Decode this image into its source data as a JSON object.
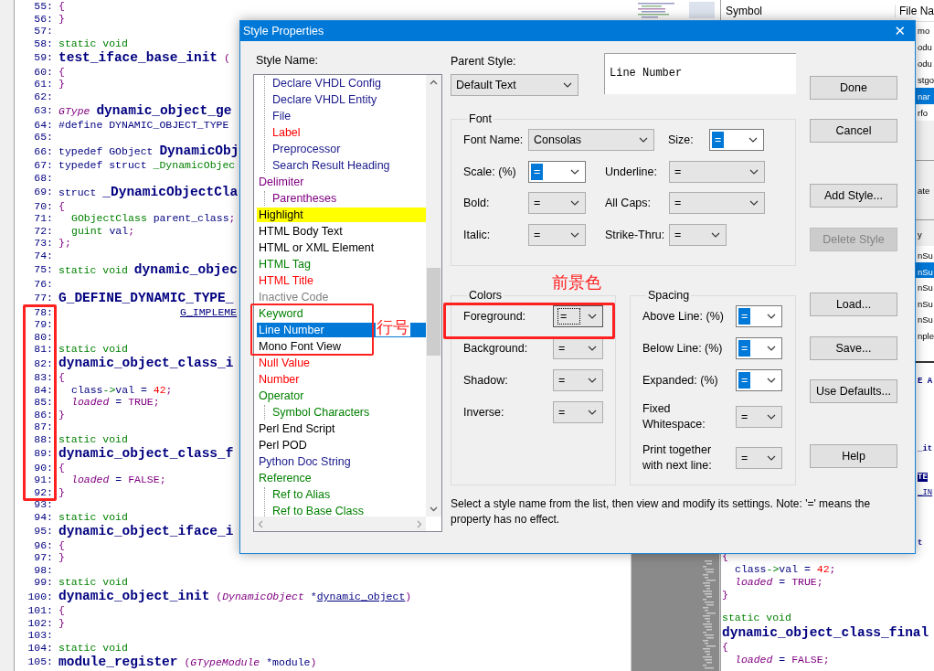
{
  "editor": {
    "lines": [
      {
        "n": "55:",
        "tokens": [
          {
            "t": "{",
            "kind": "punct"
          }
        ]
      },
      {
        "n": "56:",
        "tokens": [
          {
            "t": "}",
            "kind": "punct"
          }
        ]
      },
      {
        "n": "57:"
      },
      {
        "n": "58:",
        "tokens": [
          {
            "t": "static void",
            "kind": "kw"
          }
        ]
      },
      {
        "n": "59:",
        "tokens": [
          {
            "t": "test_iface_base_init",
            "kind": "fn"
          },
          {
            "t": " (",
            "kind": "punct"
          }
        ]
      },
      {
        "n": "60:",
        "tokens": [
          {
            "t": "{",
            "kind": "punct"
          }
        ]
      },
      {
        "n": "61:",
        "tokens": [
          {
            "t": "}",
            "kind": "punct"
          }
        ]
      },
      {
        "n": "62:"
      },
      {
        "n": "63:",
        "tokens": [
          {
            "t": "GType ",
            "kind": "type"
          },
          {
            "t": "dynamic_object_ge",
            "kind": "fn"
          }
        ]
      },
      {
        "n": "64:",
        "tokens": [
          {
            "t": "#define DYNAMIC_OBJECT_TYPE",
            "kind": "plain"
          }
        ]
      },
      {
        "n": "65:"
      },
      {
        "n": "66:",
        "tokens": [
          {
            "t": "typedef GObject ",
            "kind": "plain"
          },
          {
            "t": "DynamicObj",
            "kind": "fn"
          }
        ]
      },
      {
        "n": "67:",
        "tokens": [
          {
            "t": "typedef struct ",
            "kind": "plain"
          },
          {
            "t": "_DynamicObjec",
            "kind": "kw"
          }
        ]
      },
      {
        "n": "68:"
      },
      {
        "n": "69:",
        "tokens": [
          {
            "t": "struct ",
            "kind": "plain"
          },
          {
            "t": "_DynamicObjectCla",
            "kind": "fn"
          }
        ]
      },
      {
        "n": "70:",
        "tokens": [
          {
            "t": "{",
            "kind": "punct"
          }
        ]
      },
      {
        "n": "71:",
        "kind": "body",
        "tokens": [
          {
            "t": "GObjectClass ",
            "kind": "kw"
          },
          {
            "t": "parent_class",
            "kind": "plain"
          },
          {
            "t": ";",
            "kind": "punct"
          }
        ]
      },
      {
        "n": "72:",
        "kind": "body",
        "tokens": [
          {
            "t": "guint ",
            "kind": "kw"
          },
          {
            "t": "val",
            "kind": "plain"
          },
          {
            "t": ";",
            "kind": "punct"
          }
        ]
      },
      {
        "n": "73:",
        "tokens": [
          {
            "t": "};",
            "kind": "punct"
          }
        ]
      },
      {
        "n": "74:"
      },
      {
        "n": "75:",
        "tokens": [
          {
            "t": "static void ",
            "kind": "kw"
          },
          {
            "t": "dynamic_objec",
            "kind": "fn"
          }
        ]
      },
      {
        "n": "76:"
      },
      {
        "n": "77:",
        "tokens": [
          {
            "t": "G_DEFINE_DYNAMIC_TYPE_",
            "kind": "fn"
          }
        ]
      },
      {
        "n": "78:",
        "kind": "continuation",
        "tokens": [
          {
            "t": "G_IMPLEME",
            "kind": "link"
          }
        ]
      },
      {
        "n": "79:"
      },
      {
        "n": "80:"
      },
      {
        "n": "81:",
        "tokens": [
          {
            "t": "static void",
            "kind": "kw"
          }
        ]
      },
      {
        "n": "82:",
        "tokens": [
          {
            "t": "dynamic_object_class_i",
            "kind": "fn"
          }
        ]
      },
      {
        "n": "83:",
        "tokens": [
          {
            "t": "{",
            "kind": "punct"
          }
        ]
      },
      {
        "n": "84:",
        "kind": "body",
        "tokens": [
          {
            "t": "class",
            "kind": "plain"
          },
          {
            "t": "->",
            "kind": "kw"
          },
          {
            "t": "val = ",
            "kind": "plain"
          },
          {
            "t": "42",
            "kind": "num"
          },
          {
            "t": ";",
            "kind": "punct"
          }
        ]
      },
      {
        "n": "85:",
        "kind": "body",
        "tokens": [
          {
            "t": "loaded",
            "kind": "type"
          },
          {
            "t": " = ",
            "kind": "plain"
          },
          {
            "t": "TRUE;",
            "kind": "punct"
          }
        ]
      },
      {
        "n": "86:",
        "tokens": [
          {
            "t": "}",
            "kind": "punct"
          }
        ]
      },
      {
        "n": "87:"
      },
      {
        "n": "88:",
        "tokens": [
          {
            "t": "static void",
            "kind": "kw"
          }
        ]
      },
      {
        "n": "89:",
        "tokens": [
          {
            "t": "dynamic_object_class_f",
            "kind": "fn"
          }
        ]
      },
      {
        "n": "90:",
        "tokens": [
          {
            "t": "{",
            "kind": "punct"
          }
        ]
      },
      {
        "n": "91:",
        "kind": "body",
        "tokens": [
          {
            "t": "loaded",
            "kind": "type"
          },
          {
            "t": " = ",
            "kind": "plain"
          },
          {
            "t": "FALSE;",
            "kind": "punct"
          }
        ]
      },
      {
        "n": "92:",
        "tokens": [
          {
            "t": "}",
            "kind": "punct"
          }
        ]
      },
      {
        "n": "93:"
      },
      {
        "n": "94:",
        "tokens": [
          {
            "t": "static void",
            "kind": "kw"
          }
        ]
      },
      {
        "n": "95:",
        "tokens": [
          {
            "t": "dynamic_object_iface_i",
            "kind": "fn"
          }
        ]
      },
      {
        "n": "96:",
        "tokens": [
          {
            "t": "{",
            "kind": "punct"
          }
        ]
      },
      {
        "n": "97:",
        "tokens": [
          {
            "t": "}",
            "kind": "punct"
          }
        ]
      },
      {
        "n": "98:"
      },
      {
        "n": "99:",
        "tokens": [
          {
            "t": "static void",
            "kind": "kw"
          }
        ]
      },
      {
        "n": "100:",
        "tokens": [
          {
            "t": "dynamic_object_init",
            "kind": "fn"
          },
          {
            "t": " (",
            "kind": "punct"
          },
          {
            "t": "DynamicObject ",
            "kind": "type"
          },
          {
            "t": "*",
            "kind": "plain"
          },
          {
            "t": "dynamic_object",
            "kind": "link"
          },
          {
            "t": ")",
            "kind": "punct"
          }
        ]
      },
      {
        "n": "101:",
        "tokens": [
          {
            "t": "{",
            "kind": "punct"
          }
        ]
      },
      {
        "n": "102:",
        "tokens": [
          {
            "t": "}",
            "kind": "punct"
          }
        ]
      },
      {
        "n": "103:"
      },
      {
        "n": "104:",
        "tokens": [
          {
            "t": "static void",
            "kind": "kw"
          }
        ]
      },
      {
        "n": "105:",
        "tokens": [
          {
            "t": "module_register",
            "kind": "fn"
          },
          {
            "t": " (",
            "kind": "punct"
          },
          {
            "t": "GTypeModule ",
            "kind": "type"
          },
          {
            "t": "*module",
            "kind": "plain"
          },
          {
            "t": ")",
            "kind": "punct"
          }
        ]
      }
    ]
  },
  "right_panel": {
    "symbol_table": {
      "columns": [
        "Symbol",
        "File Na"
      ],
      "rows": [
        {
          "file": "mo",
          "selected": false
        },
        {
          "file": "odu",
          "selected": false
        },
        {
          "file": "odu",
          "selected": false
        },
        {
          "file": "stgo",
          "selected": false
        },
        {
          "file": "nar",
          "selected": true
        },
        {
          "file": "rfo",
          "selected": false
        }
      ]
    },
    "panel_text": "ate",
    "list": {
      "header": "y",
      "rows": [
        {
          "text": "nSu",
          "selected": false
        },
        {
          "text": "nSu",
          "selected": true
        },
        {
          "text": "nSu",
          "selected": false
        },
        {
          "text": "nSu",
          "selected": false
        },
        {
          "text": "nSu",
          "selected": false
        },
        {
          "text": "nple",
          "selected": false
        }
      ]
    },
    "code": {
      "lines": [
        {
          "kind": "edge",
          "tokens": [
            {
              "t": "E A",
              "kind": "fn"
            }
          ]
        },
        {
          "kind": "edge",
          "tokens": [
            {
              "t": "_it",
              "kind": "fn"
            }
          ]
        },
        {
          "kind": "edge",
          "tokens": [
            {
              "t": "TE",
              "kind": "mark"
            }
          ]
        },
        {
          "kind": "edge",
          "tokens": [
            {
              "t": "_IN",
              "kind": "link"
            }
          ]
        },
        {
          "kind": "edge",
          "tokens": [
            {
              "t": "t",
              "kind": "fn"
            }
          ]
        },
        {
          "tokens": [
            {
              "t": "{",
              "kind": "punct"
            }
          ]
        },
        {
          "kind": "body",
          "tokens": [
            {
              "t": "class",
              "kind": "plain"
            },
            {
              "t": "->",
              "kind": "kw"
            },
            {
              "t": "val = ",
              "kind": "plain"
            },
            {
              "t": "42",
              "kind": "num"
            },
            {
              "t": ";",
              "kind": "punct"
            }
          ]
        },
        {
          "kind": "body",
          "tokens": [
            {
              "t": "loaded",
              "kind": "type"
            },
            {
              "t": " = ",
              "kind": "plain"
            },
            {
              "t": "TRUE;",
              "kind": "punct"
            }
          ]
        },
        {
          "tokens": [
            {
              "t": "}",
              "kind": "punct"
            }
          ]
        },
        {
          "tokens": [
            {
              "t": "static void",
              "kind": "kw"
            }
          ]
        },
        {
          "tokens": [
            {
              "t": "dynamic_object_class_final",
              "kind": "fn"
            }
          ]
        },
        {
          "tokens": [
            {
              "t": "{",
              "kind": "punct"
            }
          ]
        },
        {
          "kind": "body",
          "tokens": [
            {
              "t": "loaded",
              "kind": "type"
            },
            {
              "t": " = ",
              "kind": "plain"
            },
            {
              "t": "FALSE;",
              "kind": "punct"
            }
          ]
        }
      ]
    }
  },
  "dialog": {
    "title": "Style Properties",
    "close": "✕",
    "style_name_label": "Style Name:",
    "style_list": {
      "items": [
        {
          "children": [
            {
              "label": "Declare VHDL Config",
              "color": "#1a1a8c",
              "selected": false
            },
            {
              "label": "Declare VHDL Entity",
              "color": "#1a1a8c",
              "selected": false
            },
            {
              "label": "File",
              "color": "#1a1a8c",
              "selected": false
            },
            {
              "label": "Label",
              "color": "#ff0000",
              "selected": false
            },
            {
              "label": "Preprocessor",
              "color": "#1a1a8c",
              "selected": false
            },
            {
              "label": "Search Result Heading",
              "color": "#1a1a8c",
              "selected": false
            }
          ]
        },
        {
          "label": "Delimiter",
          "color": "#800080",
          "selected": false,
          "children": [
            {
              "label": "Parentheses",
              "color": "#800080",
              "selected": false
            }
          ]
        },
        {
          "label": "Highlight",
          "kind": "marked",
          "selected": false
        },
        {
          "label": "HTML Body Text",
          "color": "#000000",
          "selected": false
        },
        {
          "label": "HTML or XML Element",
          "color": "#000000",
          "selected": false
        },
        {
          "label": "HTML Tag",
          "color": "#008000",
          "selected": false
        },
        {
          "label": "HTML Title",
          "color": "#ff0000",
          "selected": false
        },
        {
          "label": "Inactive Code",
          "color": "#808080",
          "selected": false
        },
        {
          "label": "Keyword",
          "color": "#008000",
          "selected": false
        },
        {
          "label": "Line Number",
          "selected": true
        },
        {
          "label": "Mono Font View",
          "color": "#000000",
          "selected": false
        },
        {
          "label": "Null Value",
          "color": "#ff0000",
          "selected": false
        },
        {
          "label": "Number",
          "color": "#ff0000",
          "selected": false
        },
        {
          "label": "Operator",
          "color": "#008000",
          "selected": false,
          "children": [
            {
              "label": "Symbol Characters",
              "color": "#008000",
              "selected": false
            }
          ]
        },
        {
          "label": "Perl End Script",
          "color": "#000000",
          "selected": false
        },
        {
          "label": "Perl POD",
          "color": "#000000",
          "selected": false
        },
        {
          "label": "Python Doc String",
          "color": "#1a1a8c",
          "selected": false
        },
        {
          "label": "Reference",
          "color": "#008000",
          "selected": false,
          "children": [
            {
              "label": "Ref to Alias",
              "color": "#008000",
              "selected": false
            },
            {
              "label": "Ref to Base Class",
              "color": "#008000",
              "selected": false
            }
          ]
        }
      ]
    },
    "parent_style": {
      "label": "Parent Style:",
      "value": "Default Text"
    },
    "preview": "Line Number",
    "font_group": {
      "title": "Font",
      "rows": [
        [
          {
            "label": "Font Name:",
            "value": "Consolas",
            "editable": false
          },
          {
            "label": "Size:",
            "value": "=",
            "editable": true
          }
        ],
        [
          {
            "label": "Scale: (%)",
            "value": "=",
            "editable": true
          },
          {
            "label": "Underline:",
            "value": "=",
            "editable": false
          }
        ],
        [
          {
            "label": "Bold:",
            "value": "=",
            "editable": false
          },
          {
            "label": "All Caps:",
            "value": "=",
            "editable": false
          }
        ],
        [
          {
            "label": "Italic:",
            "value": "=",
            "editable": false
          },
          {
            "label": "Strike-Thru:",
            "value": "=",
            "editable": false
          }
        ]
      ]
    },
    "colors_group": {
      "title": "Colors",
      "rows": [
        {
          "label": "Foreground:",
          "value": "=",
          "focused": true
        },
        {
          "label": "Background:",
          "value": "=",
          "focused": false
        },
        {
          "label": "Shadow:",
          "value": "=",
          "focused": false
        },
        {
          "label": "Inverse:",
          "value": "=",
          "focused": false
        }
      ]
    },
    "spacing_group": {
      "title": "Spacing",
      "rows": [
        {
          "label": "Above Line: (%)",
          "value": "=",
          "editable": true
        },
        {
          "label": "Below Line: (%)",
          "value": "=",
          "editable": true
        },
        {
          "label": "Expanded: (%)",
          "value": "=",
          "editable": true
        },
        {
          "label": "Fixed Whitespace:",
          "value": "=",
          "editable": false
        },
        {
          "label": "Print together with next line:",
          "value": "=",
          "editable": false
        }
      ]
    },
    "buttons": [
      {
        "label": "Done",
        "disabled": false
      },
      {
        "label": "Cancel",
        "disabled": false
      },
      {
        "label": "Add Style...",
        "disabled": false
      },
      {
        "label": "Delete Style",
        "disabled": true
      },
      {
        "label": "Load...",
        "disabled": false
      },
      {
        "label": "Save...",
        "disabled": false
      },
      {
        "label": "Use Defaults...",
        "disabled": false
      },
      {
        "label": "Help",
        "disabled": false
      }
    ],
    "hint": "Select a style name from the list, then view and modify its settings. Note: '=' means the property has no effect."
  },
  "annotations": [
    {
      "text": "行号"
    },
    {
      "text": "前景色"
    }
  ]
}
